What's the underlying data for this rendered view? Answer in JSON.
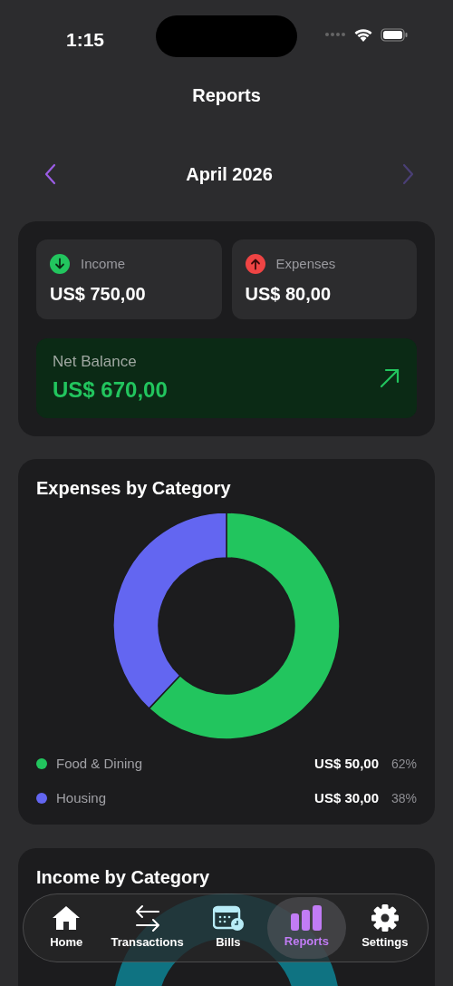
{
  "status_bar": {
    "time": "1:15"
  },
  "title": "Reports",
  "month_nav": {
    "label": "April 2026",
    "prev_disabled": false,
    "next_disabled": true
  },
  "summary": {
    "tiles": [
      {
        "kind": "income",
        "label": "Income",
        "amount": "US$ 750,00"
      },
      {
        "kind": "expense",
        "label": "Expenses",
        "amount": "US$ 80,00"
      }
    ],
    "net": {
      "label": "Net Balance",
      "amount": "US$ 670,00",
      "positive": true
    }
  },
  "expenses_by_category": {
    "title": "Expenses by Category",
    "chart_data": {
      "type": "donut",
      "categories": [
        "Food & Dining",
        "Housing"
      ],
      "series": [
        {
          "values": [
            62,
            38
          ]
        }
      ]
    },
    "legend": [
      {
        "color": "#22c55e",
        "amount": "US$ 50,00",
        "percent": "62%"
      },
      {
        "color": "#6366f1",
        "amount": "US$ 30,00",
        "percent": "38%"
      }
    ]
  },
  "income_by_category": {
    "title": "Income by Category"
  },
  "tab_bar": [
    {
      "kind": "home",
      "label": "Home",
      "selected": false
    },
    {
      "kind": "transactions",
      "label": "Transactions",
      "selected": false
    },
    {
      "kind": "bills",
      "label": "Bills",
      "selected": false
    },
    {
      "kind": "reports",
      "label": "Reports",
      "selected": true
    },
    {
      "kind": "settings",
      "label": "Settings",
      "selected": false
    }
  ]
}
